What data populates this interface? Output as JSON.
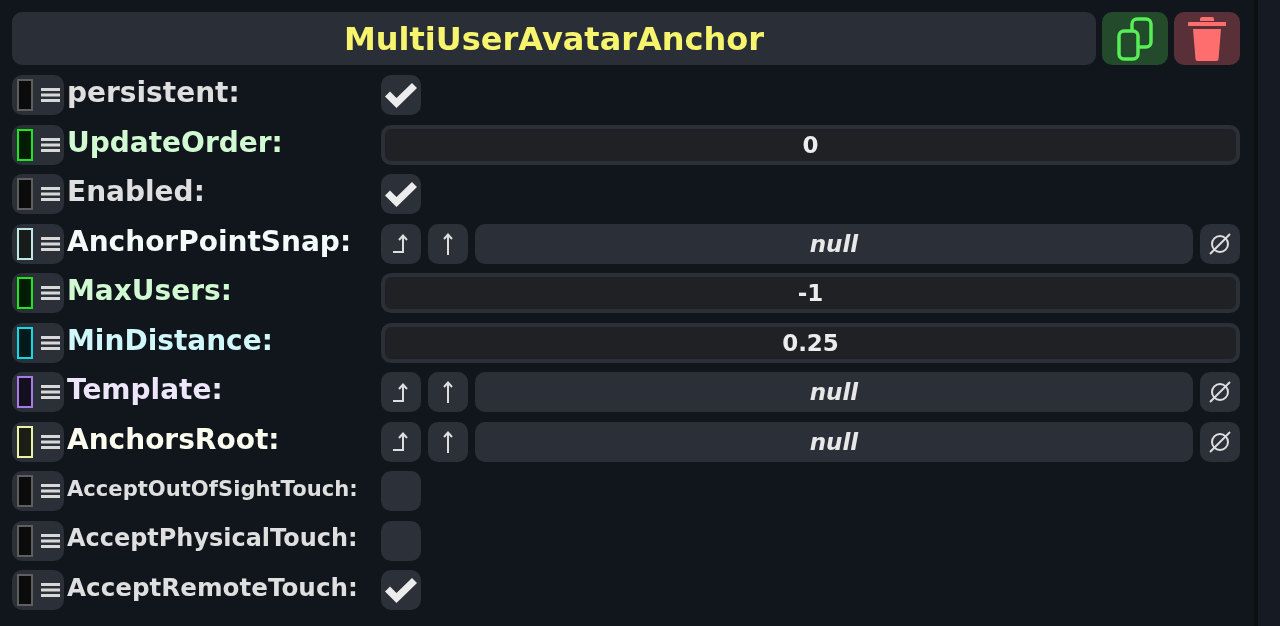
{
  "component": {
    "title": "MultiUserAvatarAnchor"
  },
  "fields": [
    {
      "kind": "checkbox",
      "label": "persistent:",
      "color": "#5e5e5e",
      "checked": true
    },
    {
      "kind": "number",
      "label": "UpdateOrder:",
      "color": "#1ee61e",
      "value": "0"
    },
    {
      "kind": "checkbox",
      "label": "Enabled:",
      "color": "#5e5e5e",
      "checked": true
    },
    {
      "kind": "reference",
      "label": "AnchorPointSnap:",
      "color": "#bfe9e2",
      "value": "null"
    },
    {
      "kind": "number",
      "label": "MaxUsers:",
      "color": "#1ee61e",
      "value": "-1"
    },
    {
      "kind": "number",
      "label": "MinDistance:",
      "color": "#12d9e6",
      "value": "0.25"
    },
    {
      "kind": "reference",
      "label": "Template:",
      "color": "#a67be8",
      "value": "null"
    },
    {
      "kind": "reference",
      "label": "AnchorsRoot:",
      "color": "#e9f2a6",
      "value": "null"
    },
    {
      "kind": "checkbox",
      "label": "AcceptOutOfSightTouch:",
      "color": "#5e5e5e",
      "checked": false
    },
    {
      "kind": "checkbox",
      "label": "AcceptPhysicalTouch:",
      "color": "#5e5e5e",
      "checked": false
    },
    {
      "kind": "checkbox",
      "label": "AcceptRemoteTouch:",
      "color": "#5e5e5e",
      "checked": true
    }
  ]
}
